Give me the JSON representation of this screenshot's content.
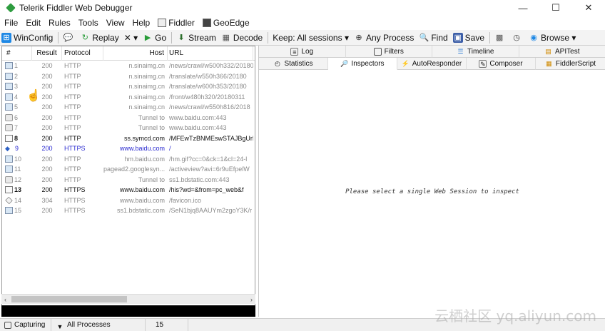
{
  "window": {
    "title": "Telerik Fiddler Web Debugger",
    "controls": [
      "—",
      "☐",
      "✕"
    ]
  },
  "menu": [
    {
      "label": "File"
    },
    {
      "label": "Edit"
    },
    {
      "label": "Rules"
    },
    {
      "label": "Tools"
    },
    {
      "label": "View"
    },
    {
      "label": "Help"
    },
    {
      "label": "Fiddler",
      "icon": "fiddler-icon"
    },
    {
      "label": "GeoEdge",
      "icon": "geoedge-icon"
    }
  ],
  "toolbar": {
    "winconfig": "WinConfig",
    "replay": "Replay",
    "remove": "✕ ▾",
    "go": "Go",
    "stream": "Stream",
    "decode": "Decode",
    "keep": "Keep: All sessions ▾",
    "process": "Any Process",
    "find": "Find",
    "save": "Save",
    "browse": "Browse ▾"
  },
  "sessions": {
    "columns": [
      "#",
      "Result",
      "Protocol",
      "Host",
      "URL"
    ],
    "rows": [
      {
        "num": "1",
        "result": "200",
        "protocol": "HTTP",
        "host": "n.sinaimg.cn",
        "url": "/news/crawl/w500h332/20180",
        "icon": "image",
        "style": "dim"
      },
      {
        "num": "2",
        "result": "200",
        "protocol": "HTTP",
        "host": "n.sinaimg.cn",
        "url": "/translate/w550h366/20180",
        "icon": "image",
        "style": "dim"
      },
      {
        "num": "3",
        "result": "200",
        "protocol": "HTTP",
        "host": "n.sinaimg.cn",
        "url": "/translate/w600h353/20180",
        "icon": "image",
        "style": "dim"
      },
      {
        "num": "4",
        "result": "200",
        "protocol": "HTTP",
        "host": "n.sinaimg.cn",
        "url": "/front/w480h320/20180311",
        "icon": "image",
        "style": "dim"
      },
      {
        "num": "5",
        "result": "200",
        "protocol": "HTTP",
        "host": "n.sinaimg.cn",
        "url": "/news/crawl/w550h816/2018",
        "icon": "image",
        "style": "dim"
      },
      {
        "num": "6",
        "result": "200",
        "protocol": "HTTP",
        "host": "Tunnel to",
        "url": "www.baidu.com:443",
        "icon": "lock",
        "style": "dim"
      },
      {
        "num": "7",
        "result": "200",
        "protocol": "HTTP",
        "host": "Tunnel to",
        "url": "www.baidu.com:443",
        "icon": "lock",
        "style": "dim"
      },
      {
        "num": "8",
        "result": "200",
        "protocol": "HTTP",
        "host": "ss.symcd.com",
        "url": "/MFEwTzBNMEswSTAJBgUrD",
        "icon": "doc",
        "style": "bold"
      },
      {
        "num": "9",
        "result": "200",
        "protocol": "HTTPS",
        "host": "www.baidu.com",
        "url": "/",
        "icon": "arrow",
        "style": "blue"
      },
      {
        "num": "10",
        "result": "200",
        "protocol": "HTTP",
        "host": "hm.baidu.com",
        "url": "/hm.gif?cc=0&ck=1&cl=24-l",
        "icon": "image",
        "style": "dim"
      },
      {
        "num": "11",
        "result": "200",
        "protocol": "HTTP",
        "host": "pagead2.googlesyn...",
        "url": "/activeview?avi=6r9uEfpelW",
        "icon": "image",
        "style": "dim"
      },
      {
        "num": "12",
        "result": "200",
        "protocol": "HTTP",
        "host": "Tunnel to",
        "url": "ss1.bdstatic.com:443",
        "icon": "lock",
        "style": "dim"
      },
      {
        "num": "13",
        "result": "200",
        "protocol": "HTTPS",
        "host": "www.baidu.com",
        "url": "/his?wd=&from=pc_web&f",
        "icon": "doc",
        "style": "bold"
      },
      {
        "num": "14",
        "result": "304",
        "protocol": "HTTPS",
        "host": "www.baidu.com",
        "url": "/favicon.ico",
        "icon": "cert",
        "style": "dim"
      },
      {
        "num": "15",
        "result": "200",
        "protocol": "HTTPS",
        "host": "ss1.bdstatic.com",
        "url": "/SeN1bjq8AAUYm2zgoY3K/r",
        "icon": "image",
        "style": "dim"
      }
    ]
  },
  "tabs_top": [
    {
      "label": "Log",
      "icon": "log-icon"
    },
    {
      "label": "Filters",
      "icon": "filters-icon"
    },
    {
      "label": "Timeline",
      "icon": "timeline-icon"
    },
    {
      "label": "APITest",
      "icon": "apitest-icon"
    }
  ],
  "tabs_bottom": [
    {
      "label": "Statistics",
      "icon": "statistics-icon"
    },
    {
      "label": "Inspectors",
      "icon": "inspectors-icon",
      "active": true
    },
    {
      "label": "AutoResponder",
      "icon": "autoresponder-icon"
    },
    {
      "label": "Composer",
      "icon": "composer-icon"
    },
    {
      "label": "FiddlerScript",
      "icon": "fiddlerscript-icon"
    }
  ],
  "inspector_message": "Please select a single Web Session to inspect",
  "status": {
    "capturing": "Capturing",
    "processes": "All Processes",
    "count": "15"
  },
  "watermark": "云栖社区 yq.aliyun.com"
}
